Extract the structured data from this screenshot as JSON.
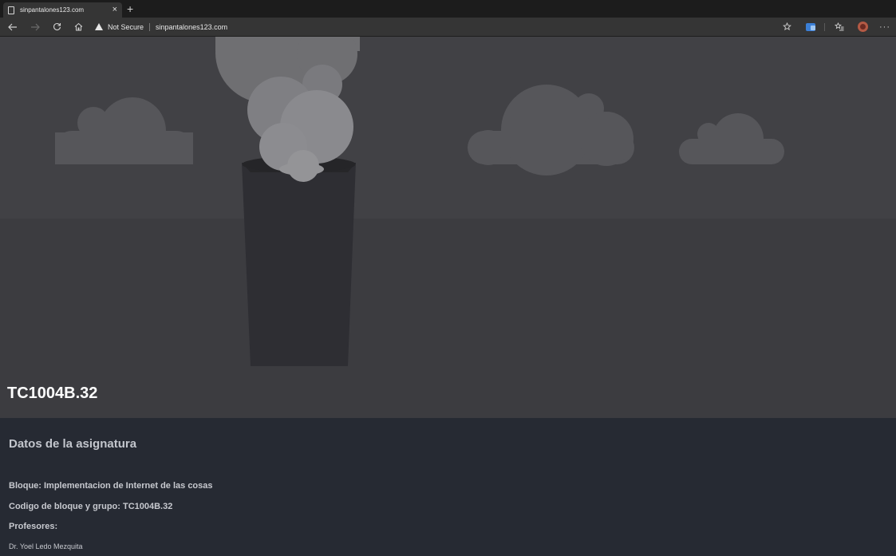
{
  "browser": {
    "tab_title": "sinpantalones123.com",
    "new_tab_symbol": "+",
    "close_symbol": "×",
    "security_label": "Not Secure",
    "url": "sinpantalones123.com",
    "icons": [
      "back-arrow-icon",
      "forward-arrow-icon",
      "refresh-icon",
      "home-icon",
      "star-icon",
      "translate-icon",
      "favorites-icon",
      "profile-avatar",
      "more-icon"
    ]
  },
  "hero": {
    "title": "TC1004B.32"
  },
  "course": {
    "heading": "Datos de la asignatura",
    "bloque": "Bloque: Implementacion de Internet de las cosas",
    "codigo": "Codigo de bloque y grupo: TC1004B.32",
    "profesores_label": "Profesores:",
    "profesor_1": "Dr. Yoel Ledo Mezquita"
  }
}
